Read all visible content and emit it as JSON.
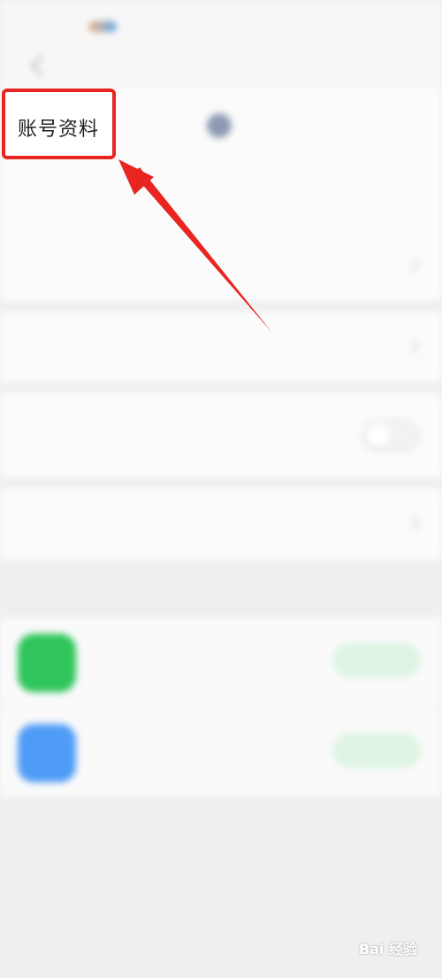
{
  "highlight": {
    "label": "账号资料"
  },
  "watermark": {
    "text": "Bai 经验"
  }
}
